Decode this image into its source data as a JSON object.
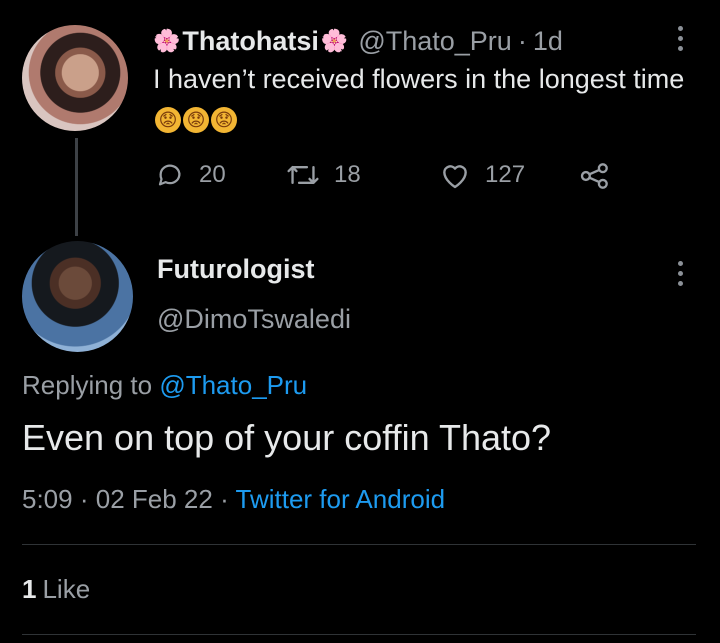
{
  "parent_tweet": {
    "display_name": "Thatohatsi",
    "flower_emoji": "🌸",
    "handle": "@Thato_Pru",
    "separator": "·",
    "time": "1d",
    "text": "I haven’t received flowers in the longest time",
    "emoji": [
      "😟",
      "😟",
      "😟"
    ],
    "replies": "20",
    "retweets": "18",
    "likes": "127"
  },
  "reply_tweet": {
    "display_name": "Futurologist",
    "handle": "@DimoTswaledi",
    "replying_label": "Replying to",
    "replying_handle": "@Thato_Pru",
    "text": "Even on top of your coffin Thato?",
    "time": "5:09",
    "date": "02 Feb 22",
    "separator": "·",
    "source": "Twitter for Android",
    "like_count": "1",
    "like_label": "Like"
  },
  "colors": {
    "background": "#000000",
    "primary_text": "#e7e9ea",
    "secondary_text": "#9a9fa5",
    "link": "#1d9bf0",
    "divider": "#2f3336"
  },
  "icons": {
    "reply": "reply-bubble-icon",
    "retweet": "retweet-icon",
    "like": "heart-icon",
    "share": "share-icon",
    "more": "more-vertical-icon"
  }
}
